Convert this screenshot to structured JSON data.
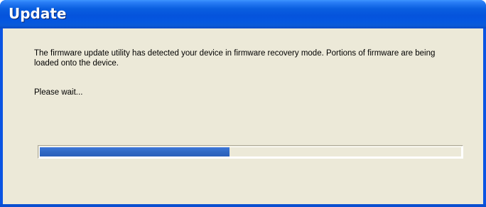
{
  "window": {
    "title": "Update"
  },
  "dialog": {
    "message": "The firmware update utility has detected your device in firmware recovery mode.  Portions of firmware are being loaded onto the device.",
    "status": "Please wait..."
  },
  "progress": {
    "fraction": 0.45,
    "fill_color": "#316ac5",
    "track_color": "#ece9d8"
  },
  "colors": {
    "titlebar": "#0553dc",
    "client_bg": "#ece9d8"
  }
}
